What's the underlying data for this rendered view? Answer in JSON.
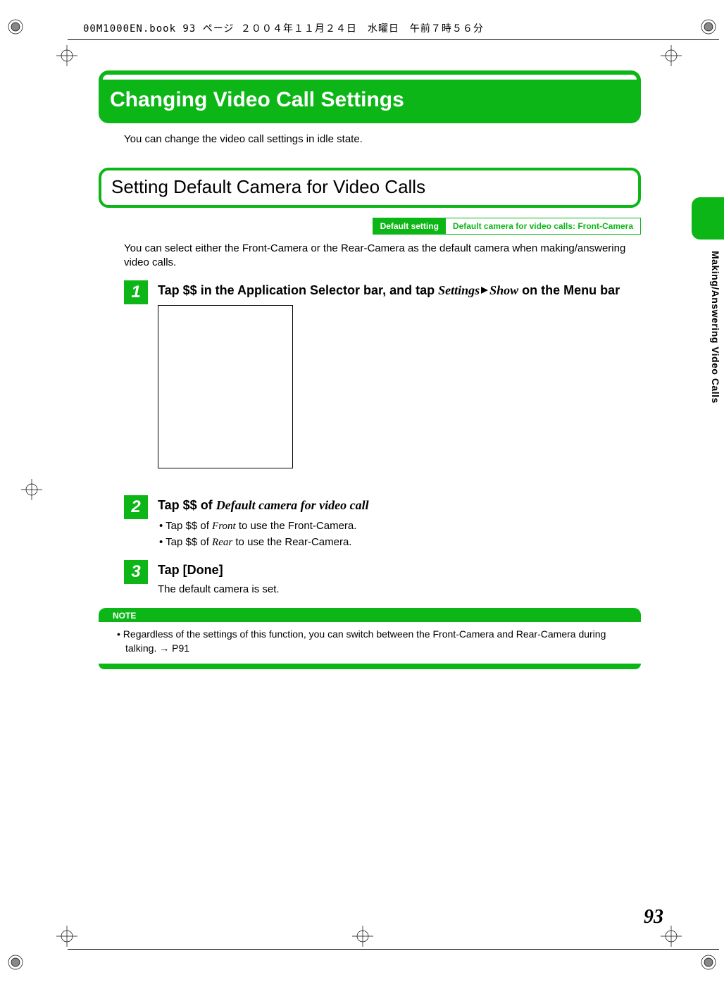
{
  "header": "00M1000EN.book  93 ページ  ２００４年１１月２４日　水曜日　午前７時５６分",
  "title": "Changing Video Call Settings",
  "intro": "You can change the video call settings in idle state.",
  "subtitle": "Setting Default Camera for Video Calls",
  "default_box": {
    "label": "Default setting",
    "value": "Default camera for video calls: Front-Camera"
  },
  "body_text": "You can select either the Front-Camera or the Rear-Camera as the default camera when making/answering video calls.",
  "steps": {
    "one": {
      "num": "1",
      "pre": "Tap $$ in the Application Selector bar, and tap ",
      "it1": "Settings",
      "mid": " ",
      "it2": "Show",
      "post": " on the Menu bar"
    },
    "two": {
      "num": "2",
      "pre": "Tap $$ of ",
      "it": "Default camera for video call",
      "b1_pre": "Tap $$ of ",
      "b1_it": "Front",
      "b1_post": " to use the Front-Camera.",
      "b2_pre": "Tap $$ of ",
      "b2_it": "Rear",
      "b2_post": " to use the Rear-Camera."
    },
    "three": {
      "num": "3",
      "title": "Tap [Done]",
      "body": "The default camera is set."
    }
  },
  "note": {
    "label": "NOTE",
    "text": "•  Regardless of the settings of this function, you can switch between the Front-Camera and Rear-Camera during talking. → P91"
  },
  "side_label": "Making/Answering Video Calls",
  "page_number": "93"
}
